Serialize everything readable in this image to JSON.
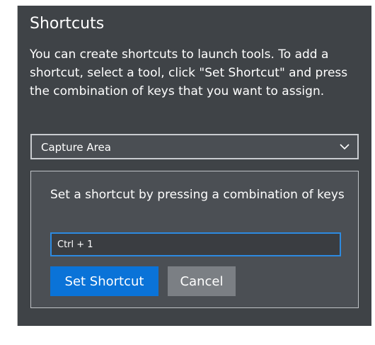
{
  "shortcuts": {
    "title": "Shortcuts",
    "description": "You can create shortcuts to launch tools. To add a shortcut, select a tool, click \"Set Shortcut\" and press the combination of keys that you want to assign.",
    "tool_select": {
      "value": "Capture Area",
      "icon": "chevron-down-icon"
    },
    "shortcut_dialog": {
      "prompt": "Set a shortcut by pressing a combination of keys",
      "input_value": "Ctrl + 1",
      "set_button_label": "Set Shortcut",
      "cancel_button_label": "Cancel"
    }
  },
  "colors": {
    "panel_bg": "#3f4347",
    "accent": "#0a73d8",
    "focus_border": "#2d8ae0",
    "cancel_bg": "#7b7f84"
  }
}
